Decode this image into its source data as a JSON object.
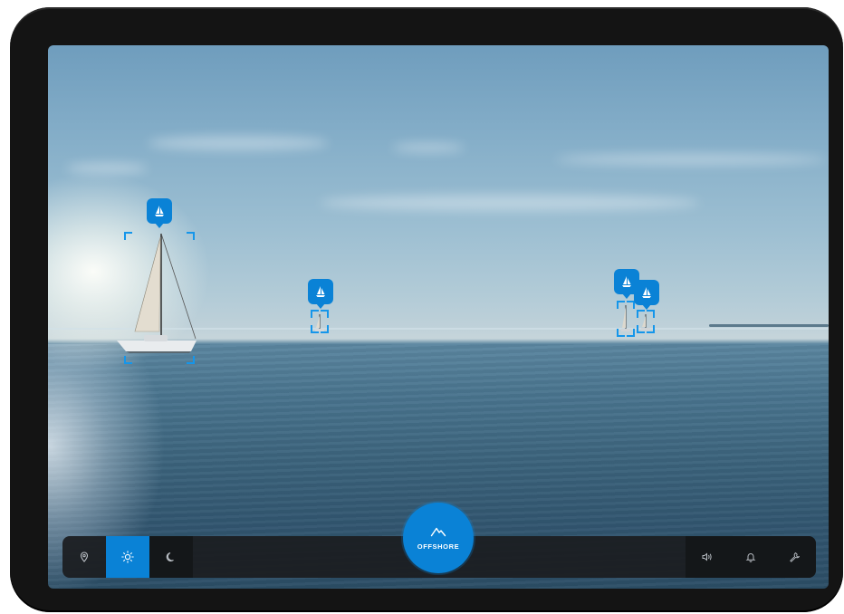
{
  "app": {
    "center_button": {
      "label": "OFFSHORE",
      "icon": "mountain-peak-icon"
    }
  },
  "toolbar": {
    "left": [
      {
        "id": "location",
        "icon": "location-pin-icon",
        "active": false
      },
      {
        "id": "day",
        "icon": "sun-icon",
        "active": true
      },
      {
        "id": "night",
        "icon": "moon-icon",
        "active": false
      }
    ],
    "right": [
      {
        "id": "sound",
        "icon": "volume-icon"
      },
      {
        "id": "alerts",
        "icon": "bell-icon"
      },
      {
        "id": "settings",
        "icon": "wrench-icon"
      }
    ]
  },
  "detections": [
    {
      "id": "boat-1",
      "icon": "sailboat-icon"
    },
    {
      "id": "boat-2",
      "icon": "sailboat-icon"
    },
    {
      "id": "boat-3",
      "icon": "sailboat-icon"
    },
    {
      "id": "boat-4",
      "icon": "sailboat-icon"
    }
  ],
  "colors": {
    "accent": "#0a82d6",
    "toolbar_bg": "#1c1e21",
    "device_frame": "#141414"
  }
}
